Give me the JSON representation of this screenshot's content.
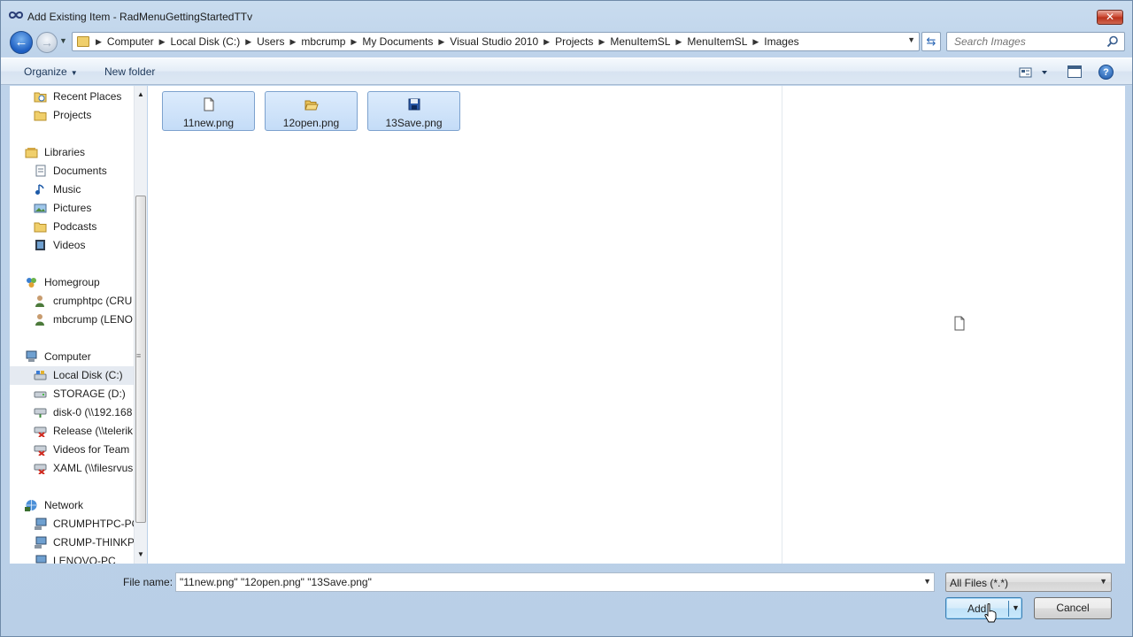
{
  "window": {
    "title": "Add Existing Item - RadMenuGettingStartedTTv"
  },
  "address": {
    "crumbs": [
      "Computer",
      "Local Disk (C:)",
      "Users",
      "mbcrump",
      "My Documents",
      "Visual Studio 2010",
      "Projects",
      "MenuItemSL",
      "MenuItemSL",
      "Images"
    ]
  },
  "search": {
    "placeholder": "Search Images"
  },
  "toolbar": {
    "organize_label": "Organize",
    "new_folder_label": "New folder"
  },
  "navpane": {
    "items": [
      {
        "label": "Recent Places",
        "icon": "recent-places-icon",
        "indent": 1
      },
      {
        "label": "Projects",
        "icon": "folder-icon",
        "indent": 1
      },
      {
        "label": "Libraries",
        "icon": "libraries-icon",
        "indent": 0
      },
      {
        "label": "Documents",
        "icon": "documents-icon",
        "indent": 1
      },
      {
        "label": "Music",
        "icon": "music-icon",
        "indent": 1
      },
      {
        "label": "Pictures",
        "icon": "pictures-icon",
        "indent": 1
      },
      {
        "label": "Podcasts",
        "icon": "folder-icon",
        "indent": 1
      },
      {
        "label": "Videos",
        "icon": "videos-icon",
        "indent": 1
      },
      {
        "label": "Homegroup",
        "icon": "homegroup-icon",
        "indent": 0
      },
      {
        "label": "crumphtpc (CRU",
        "icon": "user-icon",
        "indent": 1
      },
      {
        "label": "mbcrump (LENO",
        "icon": "user-icon",
        "indent": 1
      },
      {
        "label": "Computer",
        "icon": "computer-icon",
        "indent": 0
      },
      {
        "label": "Local Disk (C:)",
        "icon": "local-disk-icon",
        "indent": 1
      },
      {
        "label": "STORAGE (D:)",
        "icon": "drive-icon",
        "indent": 1
      },
      {
        "label": "disk-0 (\\\\192.168",
        "icon": "network-drive-icon",
        "indent": 1
      },
      {
        "label": "Release (\\\\telerik",
        "icon": "disconnected-drive-icon",
        "indent": 1
      },
      {
        "label": "Videos for Team",
        "icon": "disconnected-drive-icon",
        "indent": 1
      },
      {
        "label": "XAML (\\\\filesrvus",
        "icon": "disconnected-drive-icon",
        "indent": 1
      },
      {
        "label": "Network",
        "icon": "network-icon",
        "indent": 0
      },
      {
        "label": "CRUMPHTPC-PC",
        "icon": "network-computer-icon",
        "indent": 1
      },
      {
        "label": "CRUMP-THINKP",
        "icon": "network-computer-icon",
        "indent": 1
      },
      {
        "label": "LENOVO-PC",
        "icon": "network-computer-icon",
        "indent": 1
      }
    ]
  },
  "files": [
    {
      "name": "11new.png",
      "icon": "new-file-icon"
    },
    {
      "name": "12open.png",
      "icon": "open-folder-icon"
    },
    {
      "name": "13Save.png",
      "icon": "save-disk-icon"
    }
  ],
  "footer": {
    "file_name_label": "File name:",
    "file_name_value": "\"11new.png\" \"12open.png\" \"13Save.png\"",
    "file_type_value": "All Files (*.*)",
    "add_label": "Add",
    "cancel_label": "Cancel"
  },
  "colors": {
    "window_chrome": "#bed3ea",
    "selection": "#c4dcf7",
    "close_button": "#c9432c"
  }
}
